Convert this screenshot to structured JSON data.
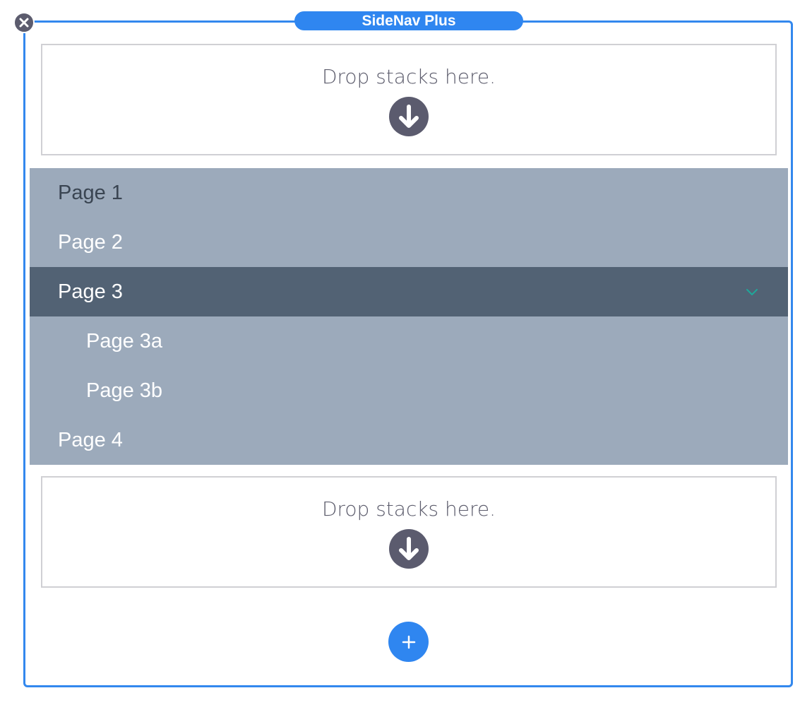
{
  "panel": {
    "title": "SideNav Plus",
    "accent_color": "#2f86f0",
    "close_icon": "close-icon",
    "add_icon": "plus-icon"
  },
  "dropzones": {
    "top": {
      "text": "Drop stacks here.",
      "icon": "arrow-down-circle-icon"
    },
    "bottom": {
      "text": "Drop stacks here.",
      "icon": "arrow-down-circle-icon"
    }
  },
  "nav": {
    "background_color": "#9caabb",
    "active_color": "#526274",
    "items": [
      {
        "label": "Page 1"
      },
      {
        "label": "Page 2"
      },
      {
        "label": "Page 3",
        "active": true,
        "expanded": true,
        "icon": "chevron-down-icon"
      },
      {
        "label": "Page 3a",
        "sub": true
      },
      {
        "label": "Page 3b",
        "sub": true
      },
      {
        "label": "Page 4"
      }
    ]
  }
}
